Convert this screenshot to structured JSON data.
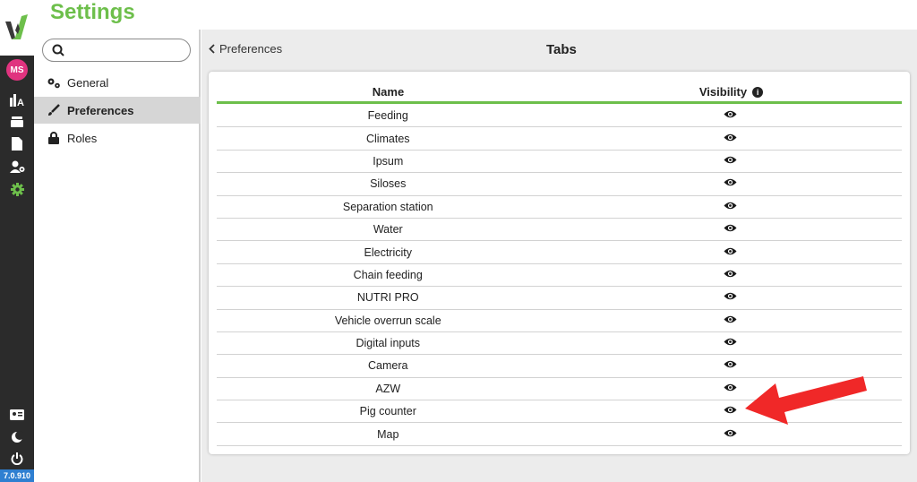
{
  "app": {
    "version": "7.0.910"
  },
  "header": {
    "title": "Settings"
  },
  "rail": {
    "avatar_initials": "MS",
    "icons": [
      "dashboard-icon",
      "layers-icon",
      "document-icon",
      "user-settings-icon",
      "settings-icon"
    ],
    "bottom_icons": [
      "id-card-icon",
      "moon-icon",
      "power-icon"
    ],
    "active_color": "#6dbf4b"
  },
  "sidebar": {
    "search": {
      "placeholder": "",
      "value": ""
    },
    "items": [
      {
        "label": "General",
        "icon": "gears-icon",
        "active": false
      },
      {
        "label": "Preferences",
        "icon": "paintbrush-icon",
        "active": true
      },
      {
        "label": "Roles",
        "icon": "lock-icon",
        "active": false
      }
    ]
  },
  "main": {
    "back_label": "Preferences",
    "title": "Tabs",
    "table": {
      "columns": [
        "Name",
        "Visibility"
      ],
      "rows": [
        {
          "name": "Feeding"
        },
        {
          "name": "Climates"
        },
        {
          "name": "Ipsum"
        },
        {
          "name": "Siloses"
        },
        {
          "name": "Separation station"
        },
        {
          "name": "Water"
        },
        {
          "name": "Electricity"
        },
        {
          "name": "Chain feeding"
        },
        {
          "name": "NUTRI PRO"
        },
        {
          "name": "Vehicle overrun scale"
        },
        {
          "name": "Digital inputs"
        },
        {
          "name": "Camera"
        },
        {
          "name": "AZW"
        },
        {
          "name": "Pig counter"
        },
        {
          "name": "Map"
        }
      ]
    }
  },
  "colors": {
    "accent": "#6dbf4b",
    "annotation_arrow": "#f02828",
    "avatar": "#e0337f",
    "version_badge": "#2f7fd1"
  }
}
